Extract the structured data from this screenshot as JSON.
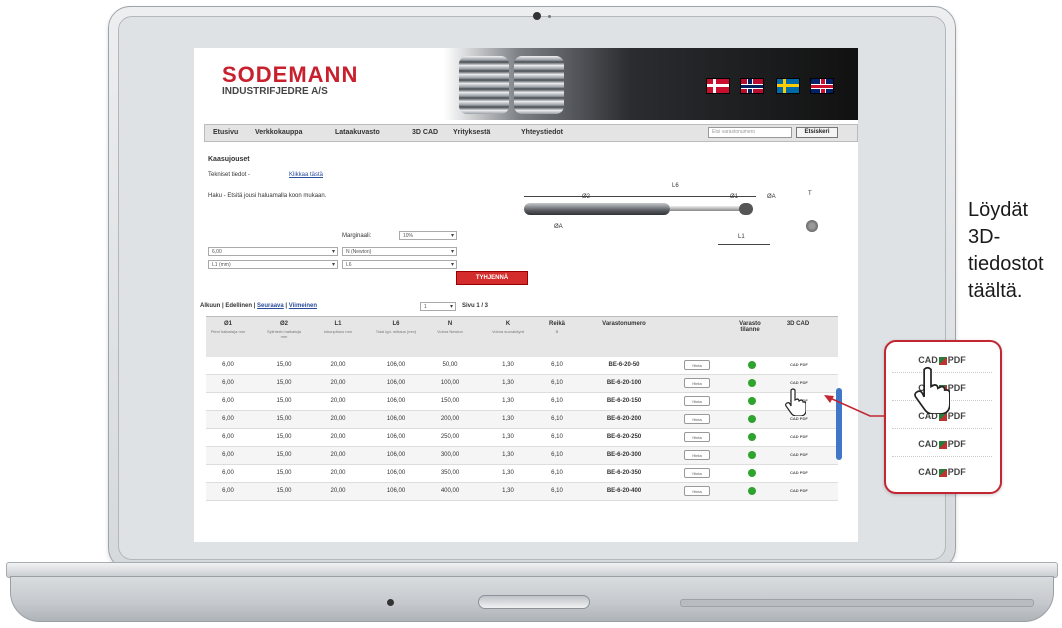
{
  "site": {
    "logo_line1": "SODEMANN",
    "logo_line2": "INDUSTRIFJEDRE A/S",
    "nav": [
      "Etusivu",
      "Verkkokauppa",
      "Lataakuvasto",
      "3D CAD",
      "Yrityksestä",
      "Yhteystiedot"
    ],
    "search_placeholder": "Etsi varastonumero",
    "search_button": "Etsiskeri"
  },
  "page": {
    "heading": "Kaasujouset",
    "tech_label": "Tekniset tiedot  -",
    "tech_link": "Klikkaa tästä",
    "search_hint": "Haku - Etsitä jousi haluamalla koon mukaan.",
    "margin_label": "Marginaali:",
    "margin_value": "10%",
    "filters": [
      "6,00",
      "N (Newton)",
      "L1 (mm)",
      "L6"
    ],
    "clear_button": "TYHJENNÄ"
  },
  "diagram": {
    "labels": [
      "L6",
      "Ø2",
      "Ø1",
      "ØA",
      "T",
      "ØA",
      "L1"
    ]
  },
  "pagination": {
    "first": "Alkuun",
    "prev": "Edellinen",
    "next": "Seuraava",
    "last": "Viimeinen",
    "page_select": "1",
    "page_info": "Sivu 1 / 3"
  },
  "table": {
    "headers": [
      {
        "title": "Ø1",
        "sub": "Pieni halkaisija mm"
      },
      {
        "title": "Ø2",
        "sub": "Sylinterin halkaisija mm"
      },
      {
        "title": "L1",
        "sub": "Iskunpituus mm"
      },
      {
        "title": "L6",
        "sub": "Total lgd. mittaus (mm)"
      },
      {
        "title": "N",
        "sub": "Voima Newton"
      },
      {
        "title": "K",
        "sub": "Voima suorakäyrä"
      },
      {
        "title": "Reikä",
        "sub": "B"
      },
      {
        "title": "Varastonumero",
        "sub": ""
      },
      {
        "title": "Varasto tilanne",
        "sub": ""
      },
      {
        "title": "3D CAD",
        "sub": ""
      }
    ],
    "order_label": "Hinta",
    "cad_label": "CAD PDF",
    "rows": [
      {
        "d1": "6,00",
        "d2": "15,00",
        "l1": "20,00",
        "l6": "106,00",
        "n": "50,00",
        "k": "1,30",
        "hole": "6,10",
        "sku": "BE-6-20-50"
      },
      {
        "d1": "6,00",
        "d2": "15,00",
        "l1": "20,00",
        "l6": "106,00",
        "n": "100,00",
        "k": "1,30",
        "hole": "6,10",
        "sku": "BE-6-20-100"
      },
      {
        "d1": "6,00",
        "d2": "15,00",
        "l1": "20,00",
        "l6": "106,00",
        "n": "150,00",
        "k": "1,30",
        "hole": "6,10",
        "sku": "BE-6-20-150"
      },
      {
        "d1": "6,00",
        "d2": "15,00",
        "l1": "20,00",
        "l6": "106,00",
        "n": "200,00",
        "k": "1,30",
        "hole": "6,10",
        "sku": "BE-6-20-200"
      },
      {
        "d1": "6,00",
        "d2": "15,00",
        "l1": "20,00",
        "l6": "106,00",
        "n": "250,00",
        "k": "1,30",
        "hole": "6,10",
        "sku": "BE-6-20-250"
      },
      {
        "d1": "6,00",
        "d2": "15,00",
        "l1": "20,00",
        "l6": "106,00",
        "n": "300,00",
        "k": "1,30",
        "hole": "6,10",
        "sku": "BE-6-20-300"
      },
      {
        "d1": "6,00",
        "d2": "15,00",
        "l1": "20,00",
        "l6": "106,00",
        "n": "350,00",
        "k": "1,30",
        "hole": "6,10",
        "sku": "BE-6-20-350"
      },
      {
        "d1": "6,00",
        "d2": "15,00",
        "l1": "20,00",
        "l6": "106,00",
        "n": "400,00",
        "k": "1,30",
        "hole": "6,10",
        "sku": "BE-6-20-400"
      }
    ]
  },
  "callout": {
    "cad": "CAD",
    "pdf": "PDF",
    "side_text": [
      "Löydät",
      "3D-",
      "tiedostot",
      "täältä."
    ]
  },
  "colors": {
    "brand_red": "#c9202e",
    "stock_green": "#2ea32e",
    "callout_red": "#c22633"
  }
}
